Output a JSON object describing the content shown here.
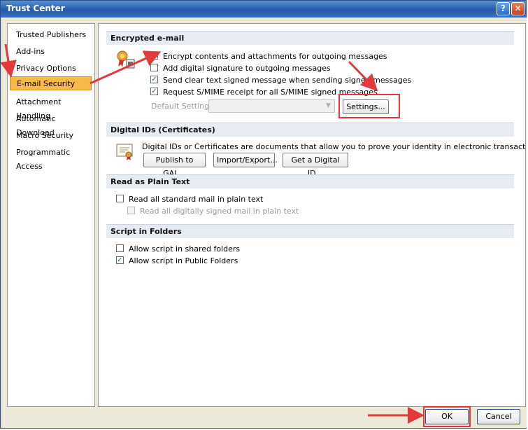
{
  "window": {
    "title": "Trust Center",
    "help_glyph": "?",
    "close_glyph": "✕"
  },
  "sidebar": {
    "items": [
      {
        "label": "Trusted Publishers"
      },
      {
        "label": "Add-ins"
      },
      {
        "label": "Privacy Options"
      },
      {
        "label": "E-mail Security",
        "selected": true
      },
      {
        "label": "Attachment Handling"
      },
      {
        "label": "Automatic Download"
      },
      {
        "label": "Macro Security"
      },
      {
        "label": "Programmatic Access"
      }
    ]
  },
  "encrypted_email": {
    "heading": "Encrypted e-mail",
    "options": [
      {
        "label": "Encrypt contents and attachments for outgoing messages",
        "checked": true
      },
      {
        "label": "Add digital signature to outgoing messages",
        "checked": false
      },
      {
        "label": "Send clear text signed message when sending signed messages",
        "checked": true
      },
      {
        "label": "Request S/MIME receipt for all S/MIME signed messages",
        "checked": true
      }
    ],
    "default_setting_label": "Default Setting:",
    "default_setting_value": "",
    "settings_button": "Settings..."
  },
  "digital_ids": {
    "heading": "Digital IDs (Certificates)",
    "description": "Digital IDs or Certificates are documents that allow you to prove your identity in electronic transactions.",
    "buttons": [
      "Publish to GAL...",
      "Import/Export...",
      "Get a Digital ID..."
    ]
  },
  "plain_text": {
    "heading": "Read as Plain Text",
    "options": [
      {
        "label": "Read all standard mail in plain text",
        "checked": false
      },
      {
        "label": "Read all digitally signed mail in plain text",
        "checked": false,
        "disabled": true
      }
    ]
  },
  "script_folders": {
    "heading": "Script in Folders",
    "options": [
      {
        "label": "Allow script in shared folders",
        "checked": false
      },
      {
        "label": "Allow script in Public Folders",
        "checked": true
      }
    ]
  },
  "footer": {
    "ok": "OK",
    "cancel": "Cancel"
  },
  "colors": {
    "annotation_red": "#e03a3a",
    "selected_item": "#f7b94b",
    "titlebar_blue": "#2f64b5"
  },
  "check_glyph": "✓"
}
